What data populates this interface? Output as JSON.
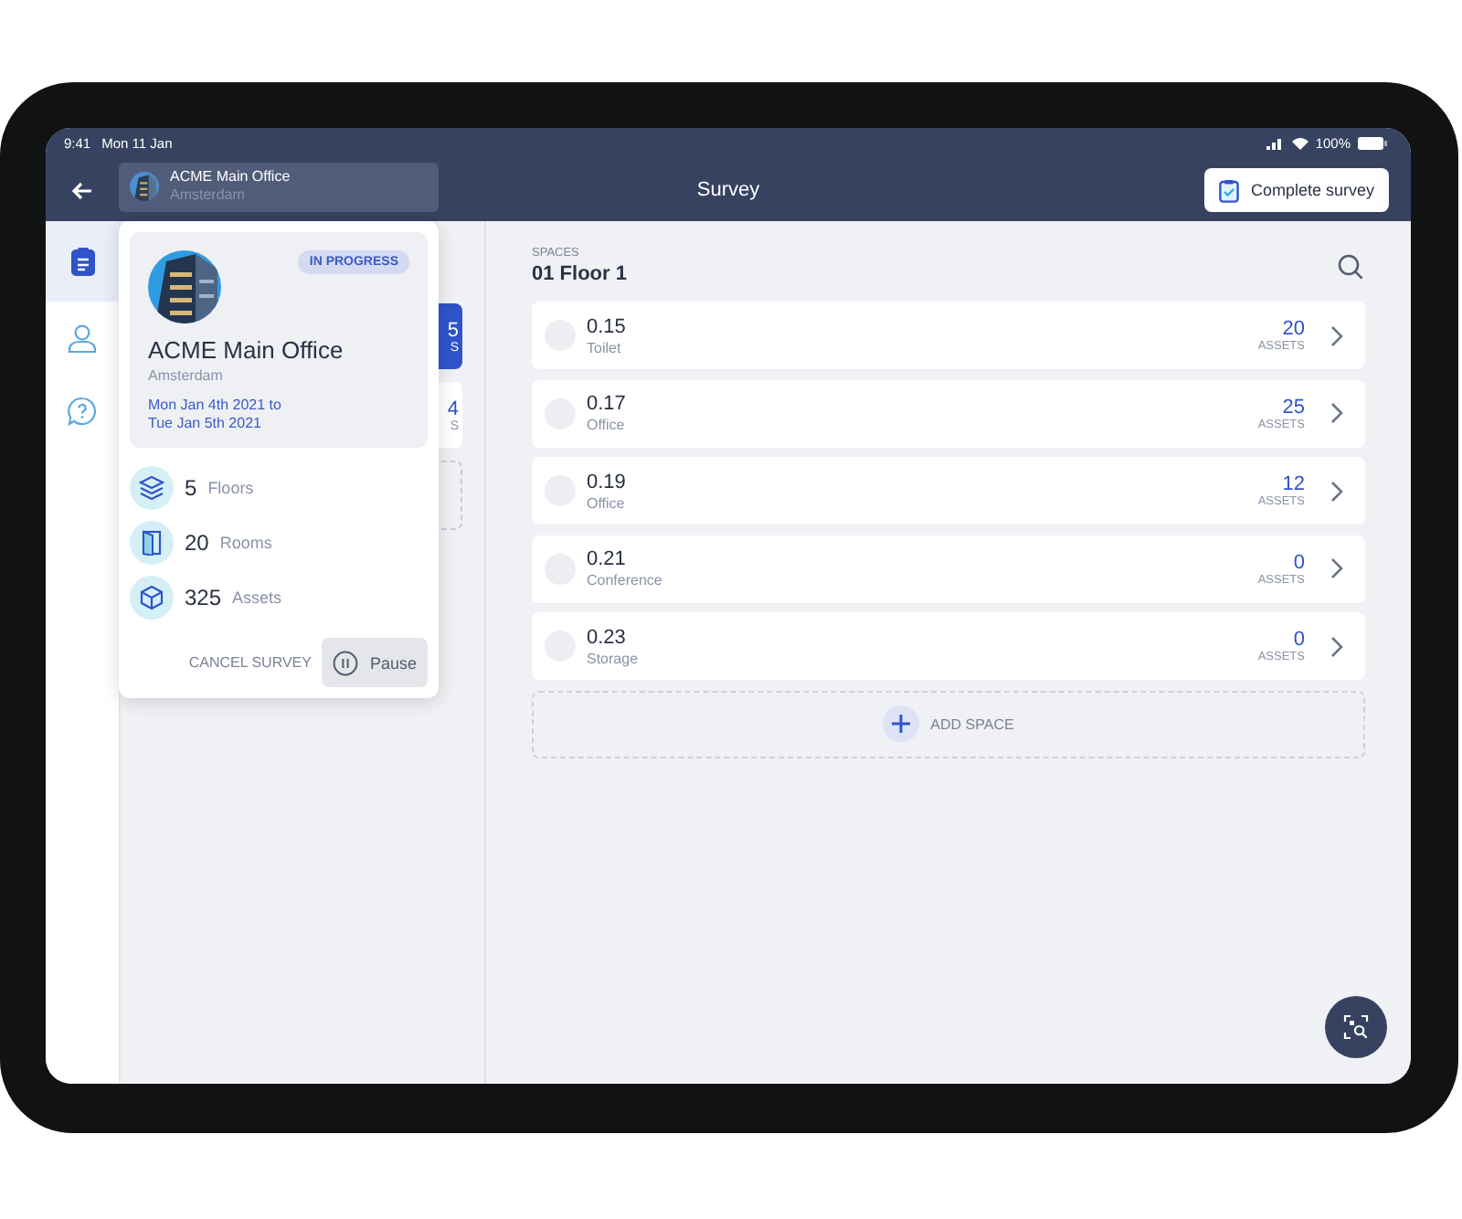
{
  "status_bar": {
    "time": "9:41",
    "date": "Mon 11 Jan",
    "battery": "100%"
  },
  "header": {
    "title": "Survey",
    "location": {
      "name": "ACME Main Office",
      "city": "Amsterdam"
    },
    "complete_button": "Complete survey"
  },
  "sidebar": {
    "items": [
      {
        "kind": "clipboard",
        "selected": true
      },
      {
        "kind": "person",
        "selected": false
      },
      {
        "kind": "help",
        "selected": false
      }
    ]
  },
  "floors": [
    {
      "count": "5",
      "label": "S",
      "selected": true
    },
    {
      "count": "4",
      "label": "S",
      "selected": false
    }
  ],
  "popover": {
    "status": "IN PROGRESS",
    "name": "ACME Main Office",
    "city": "Amsterdam",
    "dates": [
      "Mon Jan 4th 2021 to",
      "Tue Jan 5th 2021"
    ],
    "stats": [
      {
        "kind": "floors",
        "count": "5",
        "label": "Floors"
      },
      {
        "kind": "rooms",
        "count": "20",
        "label": "Rooms"
      },
      {
        "kind": "assets",
        "count": "325",
        "label": "Assets"
      }
    ],
    "cancel": "CANCEL SURVEY",
    "pause": "Pause"
  },
  "spaces": {
    "label": "SPACES",
    "floor": "01 Floor 1",
    "add": "ADD SPACE",
    "rows": [
      {
        "number": "0.15",
        "type": "Toilet",
        "count": "20",
        "unit": "ASSETS"
      },
      {
        "number": "0.17",
        "type": "Office",
        "count": "25",
        "unit": "ASSETS"
      },
      {
        "number": "0.19",
        "type": "Office",
        "count": "12",
        "unit": "ASSETS"
      },
      {
        "number": "0.21",
        "type": "Conference",
        "count": "0",
        "unit": "ASSETS"
      },
      {
        "number": "0.23",
        "type": "Storage",
        "count": "0",
        "unit": "ASSETS"
      }
    ]
  }
}
